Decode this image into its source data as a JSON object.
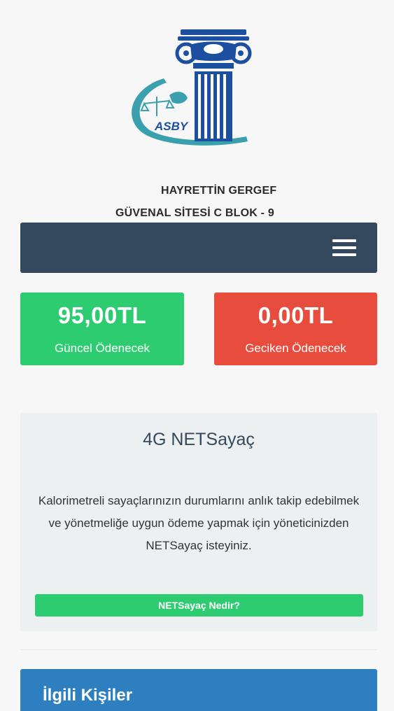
{
  "logo": {
    "text": "ASBY",
    "icon": "column-logo-icon",
    "colors": {
      "blue": "#1d4fa0",
      "teal": "#3aa0ad"
    }
  },
  "user": {
    "name": "HAYRETTİN GERGEF",
    "address": "GÜVENAL SİTESİ C BLOK - 9"
  },
  "navbar": {
    "color": "#34495e",
    "menu_icon": "hamburger-menu-icon"
  },
  "stats": {
    "current": {
      "amount": "95,00TL",
      "label": "Güncel Ödenecek",
      "color": "#2ecc71"
    },
    "overdue": {
      "amount": "0,00TL",
      "label": "Geciken Ödenecek",
      "color": "#e74c3c"
    }
  },
  "netsayac": {
    "title": "4G NETSayaç",
    "description": "Kalorimetreli sayaçlarınızın durumlarını anlık takip edebilmek ve yönetmeliğe uygun ödeme yapmak için yöneticinizden NETSayaç isteyiniz.",
    "button_label": "NETSayaç Nedir?"
  },
  "contacts": {
    "title": "İlgili Kişiler",
    "color": "#2d7fc0"
  }
}
